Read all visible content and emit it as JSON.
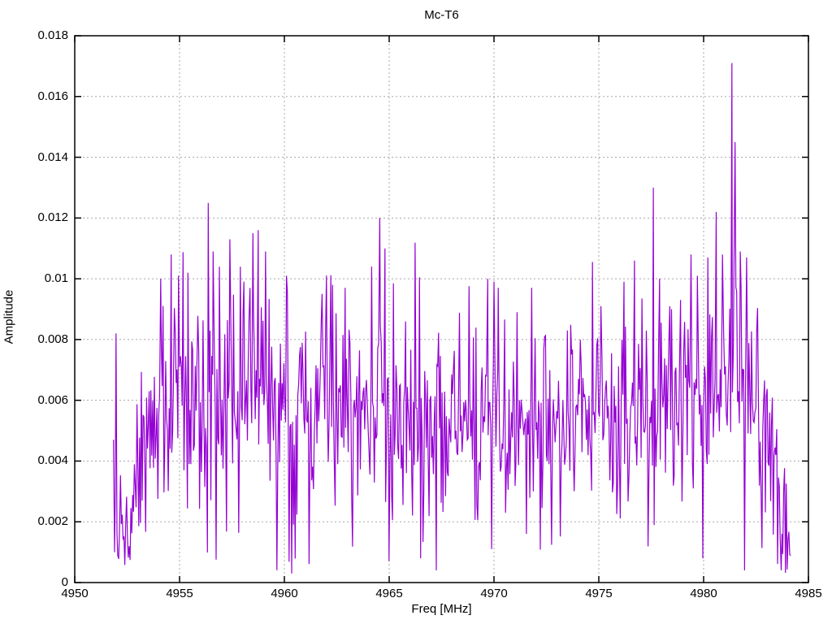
{
  "chart_data": {
    "type": "line",
    "title": "Mc-T6",
    "xlabel": "Freq [MHz]",
    "ylabel": "Amplitude",
    "xlim": [
      4950,
      4985
    ],
    "ylim": [
      0,
      0.018
    ],
    "xticks": [
      [
        4950,
        "4950"
      ],
      [
        4955,
        "4955"
      ],
      [
        4960,
        "4960"
      ],
      [
        4965,
        "4965"
      ],
      [
        4970,
        "4970"
      ],
      [
        4975,
        "4975"
      ],
      [
        4980,
        "4980"
      ],
      [
        4985,
        "4985"
      ]
    ],
    "yticks": [
      [
        0,
        "0"
      ],
      [
        0.002,
        "0.002"
      ],
      [
        0.004,
        "0.004"
      ],
      [
        0.006,
        "0.006"
      ],
      [
        0.008,
        "0.008"
      ],
      [
        0.01,
        "0.01"
      ],
      [
        0.012,
        "0.012"
      ],
      [
        0.014,
        "0.014"
      ],
      [
        0.016,
        "0.016"
      ],
      [
        0.018,
        "0.018"
      ]
    ],
    "grid": {
      "show": true,
      "dash": "2 3"
    },
    "legend": null,
    "colors": {
      "line": "#9400d3",
      "grid": "#a8a8a8",
      "border": "#000000",
      "background": "#ffffff",
      "text": "#000000"
    },
    "series": [
      {
        "name": "Mc-T6",
        "color": "#9400d3",
        "x_start": 4951.85,
        "x_end": 4984.15,
        "n_points": 780,
        "seed": 1337,
        "envelope": [
          [
            4951.85,
            0.0028,
            0.0018
          ],
          [
            4952.6,
            0.002,
            0.0013
          ],
          [
            4953.3,
            0.0048,
            0.0026
          ],
          [
            4954.2,
            0.0058,
            0.0028
          ],
          [
            4956.0,
            0.0058,
            0.0028
          ],
          [
            4958.6,
            0.0064,
            0.0028
          ],
          [
            4959.8,
            0.006,
            0.0027
          ],
          [
            4961.2,
            0.0052,
            0.0026
          ],
          [
            4963.0,
            0.0057,
            0.0026
          ],
          [
            4965.2,
            0.0055,
            0.0025
          ],
          [
            4967.2,
            0.005,
            0.0025
          ],
          [
            4969.2,
            0.0055,
            0.0025
          ],
          [
            4971.2,
            0.0057,
            0.0025
          ],
          [
            4973.2,
            0.0054,
            0.0024
          ],
          [
            4975.2,
            0.0056,
            0.0025
          ],
          [
            4976.6,
            0.006,
            0.0027
          ],
          [
            4978.2,
            0.0061,
            0.0028
          ],
          [
            4980.0,
            0.0062,
            0.0029
          ],
          [
            4981.6,
            0.0067,
            0.0029
          ],
          [
            4982.6,
            0.0058,
            0.0024
          ],
          [
            4983.4,
            0.0038,
            0.0018
          ],
          [
            4983.9,
            0.0016,
            0.0011
          ],
          [
            4984.15,
            0.0008,
            0.0005
          ]
        ],
        "forced_points": [
          [
            4951.85,
            0.0047
          ],
          [
            4951.9,
            0.001
          ],
          [
            4951.97,
            0.0082
          ],
          [
            4952.05,
            0.0009
          ],
          [
            4954.1,
            0.01
          ],
          [
            4954.6,
            0.0108
          ],
          [
            4954.95,
            0.0101
          ],
          [
            4955.4,
            0.0102
          ],
          [
            4956.6,
            0.0109
          ],
          [
            4956.9,
            0.0104
          ],
          [
            4957.4,
            0.0113
          ],
          [
            4957.9,
            0.0104
          ],
          [
            4958.5,
            0.0115
          ],
          [
            4958.75,
            0.0116
          ],
          [
            4959.1,
            0.0109
          ],
          [
            4960.1,
            0.0101
          ],
          [
            4960.35,
            0.0003
          ],
          [
            4961.8,
            0.0095
          ],
          [
            4962.3,
            0.0098
          ],
          [
            4962.9,
            0.0097
          ],
          [
            4964.55,
            0.012
          ],
          [
            4964.8,
            0.011
          ],
          [
            4966.5,
            0.0008
          ],
          [
            4967.25,
            0.0004
          ],
          [
            4969.7,
            0.01
          ],
          [
            4970.0,
            0.0099
          ],
          [
            4970.2,
            0.0097
          ],
          [
            4971.1,
            0.0089
          ],
          [
            4971.8,
            0.0097
          ],
          [
            4973.5,
            0.0083
          ],
          [
            4975.1,
            0.0091
          ],
          [
            4976.2,
            0.0099
          ],
          [
            4976.7,
            0.0106
          ],
          [
            4977.6,
            0.013
          ],
          [
            4977.9,
            0.01
          ],
          [
            4978.9,
            0.0093
          ],
          [
            4979.4,
            0.0108
          ],
          [
            4979.7,
            0.0101
          ],
          [
            4980.2,
            0.0107
          ],
          [
            4980.6,
            0.0122
          ],
          [
            4980.9,
            0.0108
          ],
          [
            4981.35,
            0.0171
          ],
          [
            4981.5,
            0.0145
          ],
          [
            4981.75,
            0.0109
          ],
          [
            4982.05,
            0.0107
          ],
          [
            4983.7,
            0.0004
          ]
        ],
        "noise": {
          "dip_prob": 0.03,
          "spike_prob": 0.02
        }
      }
    ]
  }
}
